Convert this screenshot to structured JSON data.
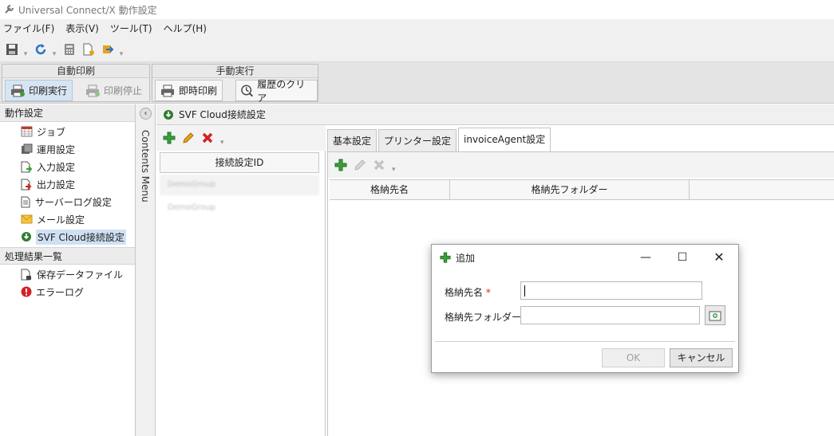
{
  "window": {
    "title": "Universal Connect/X 動作設定",
    "icon": "wrench-icon"
  },
  "menu": [
    "ファイル(F)",
    "表示(V)",
    "ツール(T)",
    "ヘルプ(H)"
  ],
  "ribbon": {
    "auto_print": {
      "title": "自動印刷",
      "run_label": "印刷実行",
      "stop_label": "印刷停止"
    },
    "manual_run": {
      "title": "手動実行",
      "print_now_label": "即時印刷",
      "clear_history_label": "履歴のクリア"
    }
  },
  "left_panel": {
    "section1_title": "動作設定",
    "items": [
      "ジョブ",
      "運用設定",
      "入力設定",
      "出力設定",
      "サーバーログ設定",
      "メール設定",
      "SVF Cloud接続設定"
    ],
    "section2_title": "処理結果一覧",
    "items2": [
      "保存データファイル",
      "エラーログ"
    ]
  },
  "contents_menu_label": "Contents Menu",
  "content": {
    "title": "SVF Cloud接続設定",
    "list_header": "接続設定ID",
    "list_rows": [
      "DemoGroup",
      "DemoGroup"
    ],
    "tabs": [
      "基本設定",
      "プリンター設定",
      "invoiceAgent設定"
    ],
    "grid_columns": [
      "格納先名",
      "格納先フォルダー"
    ]
  },
  "dialog": {
    "title": "追加",
    "field1_label": "格納先名",
    "field2_label": "格納先フォルダー",
    "required_mark": "*",
    "field1_value": "",
    "field2_value": "",
    "ok_label": "OK",
    "cancel_label": "キャンセル"
  },
  "colors": {
    "selection": "#cfe0f3",
    "green": "#3aa03a",
    "red": "#d22222",
    "required": "#dd2222"
  }
}
